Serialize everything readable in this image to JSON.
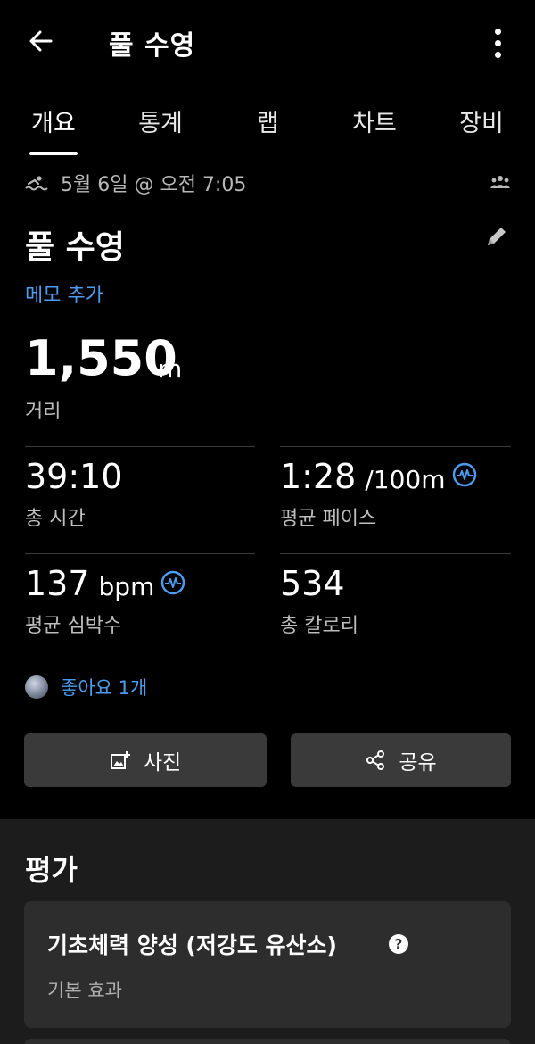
{
  "header": {
    "title": "풀 수영"
  },
  "tabs": [
    {
      "label": "개요",
      "active": true
    },
    {
      "label": "통계"
    },
    {
      "label": "랩"
    },
    {
      "label": "차트"
    },
    {
      "label": "장비"
    }
  ],
  "activity": {
    "date": "5월 6일 @ 오전 7:05",
    "title": "풀 수영",
    "memo_link": "메모 추가"
  },
  "distance": {
    "value": "1,550",
    "unit": "m",
    "label": "거리"
  },
  "stats": {
    "total_time": {
      "value": "39:10",
      "label": "총 시간"
    },
    "avg_pace": {
      "value": "1:28",
      "unit": "/100m",
      "label": "평균 페이스"
    },
    "avg_hr": {
      "value": "137",
      "unit": "bpm",
      "label": "평균 심박수"
    },
    "calories": {
      "value": "534",
      "label": "총 칼로리"
    }
  },
  "likes": {
    "text": "좋아요 1개"
  },
  "buttons": {
    "photo": "사진",
    "share": "공유"
  },
  "evaluation": {
    "section_title": "평가",
    "card_title": "기초체력 양성 (저강도 유산소)",
    "card_subtitle": "기본 효과"
  },
  "colors": {
    "accent": "#4a9df2",
    "background": "#000000",
    "card": "#2d2d2d",
    "button": "#3a3a3a"
  }
}
